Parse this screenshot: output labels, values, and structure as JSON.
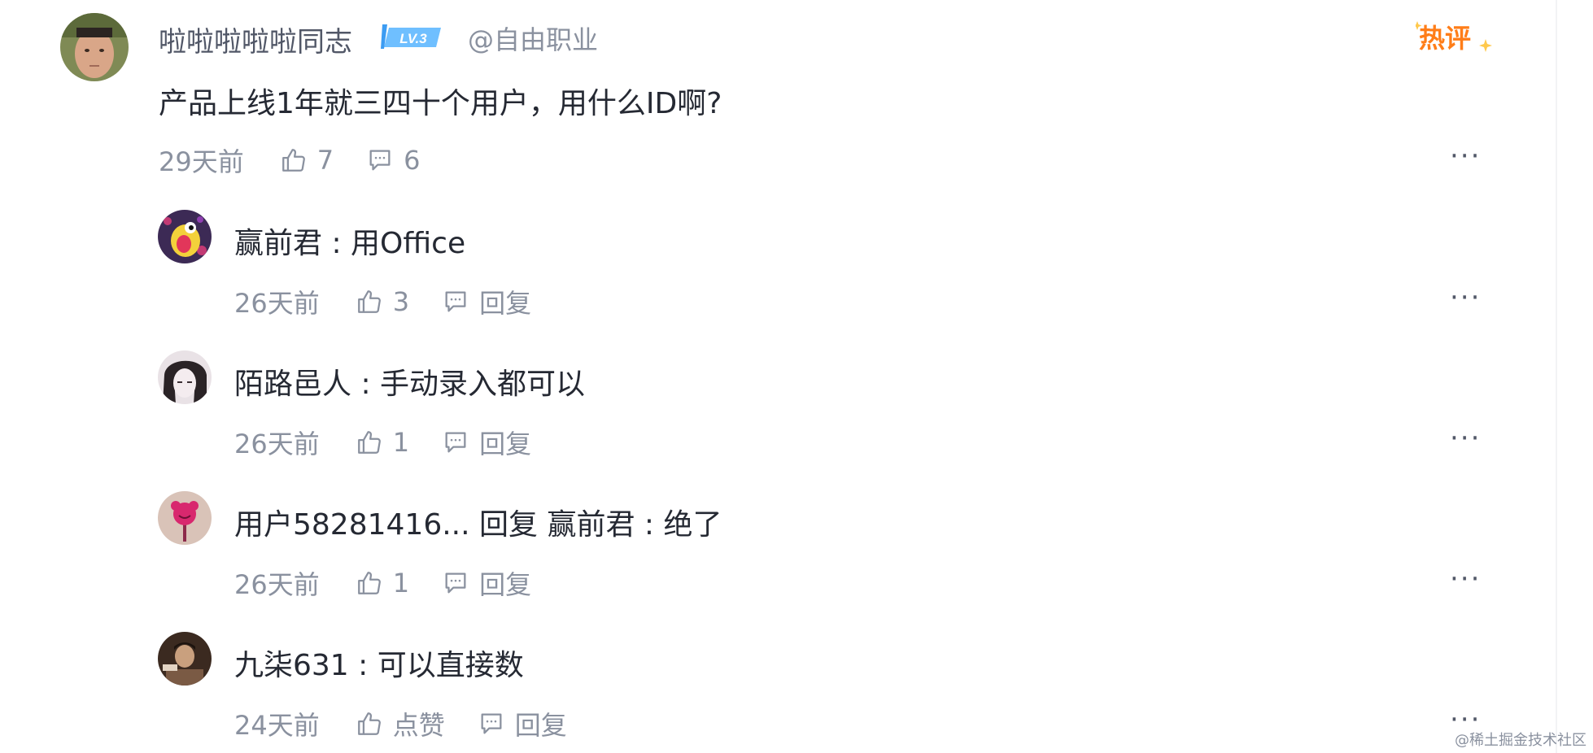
{
  "main_comment": {
    "username": "啦啦啦啦啦同志",
    "level": "LV.3",
    "job": "@自由职业",
    "hot_badge": "热评",
    "content": "产品上线1年就三四十个用户，用什么ID啊?",
    "time": "29天前",
    "likes": "7",
    "comments": "6",
    "more": "···"
  },
  "replies": [
    {
      "text": "赢前君 : 用Office",
      "time": "26天前",
      "likes": "3",
      "reply_label": "回复",
      "more": "···"
    },
    {
      "text": "陌路邑人 : 手动录入都可以",
      "time": "26天前",
      "likes": "1",
      "reply_label": "回复",
      "more": "···"
    },
    {
      "text": "用户58281416... 回复 赢前君 : 绝了",
      "time": "26天前",
      "likes": "1",
      "reply_label": "回复",
      "more": "···"
    },
    {
      "text": "九柒631 : 可以直接数",
      "time": "24天前",
      "likes": "点赞",
      "reply_label": "回复",
      "more": "···"
    }
  ],
  "watermark": "@稀土掘金技术社区",
  "colors": {
    "text": "#252933",
    "muted": "#8a919f",
    "level_badge": "#5ab3ff",
    "hot": "#ff7d18"
  }
}
